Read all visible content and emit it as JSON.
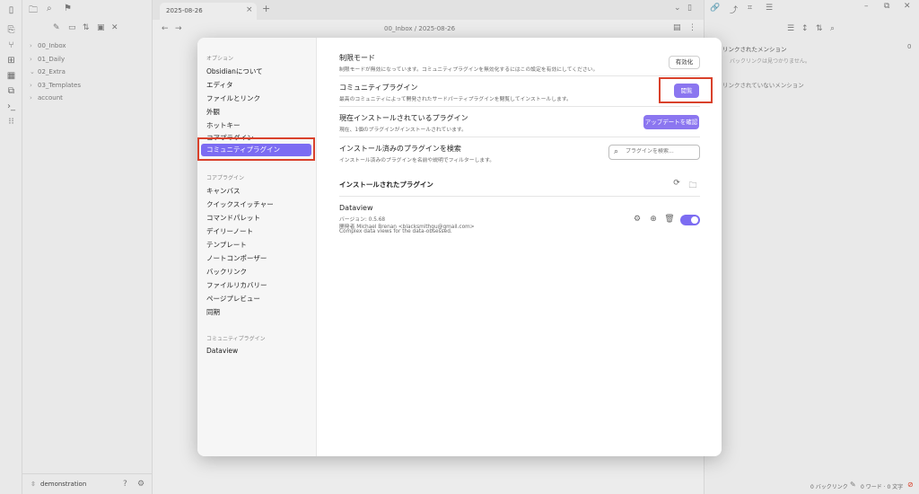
{
  "tab": {
    "title": "2025-08-26",
    "new_tab": "+"
  },
  "breadcrumb": {
    "path": "00_Inbox / 2025-08-26"
  },
  "file_tree": [
    "00_Inbox",
    "01_Daily",
    "02_Extra",
    "03_Templates",
    "account"
  ],
  "vault": {
    "name": "demonstration"
  },
  "right_panel": {
    "linked_title": "リンクされたメンション",
    "linked_empty": "バックリンクは見つかりません。",
    "unlinked_title": "リンクされていないメンション"
  },
  "status_bar": {
    "backlinks": "0 バックリンク",
    "words": "0 ワード · 0 文字"
  },
  "settings": {
    "section_options": "オプション",
    "options": [
      "Obsidianについて",
      "エディタ",
      "ファイルとリンク",
      "外観",
      "ホットキー",
      "コアプラグイン"
    ],
    "active_item": "コミュニティプラグイン",
    "section_core": "コアプラグイン",
    "core_plugins": [
      "キャンバス",
      "クイックスイッチャー",
      "コマンドパレット",
      "デイリーノート",
      "テンプレート",
      "ノートコンポーザー",
      "バックリンク",
      "ファイルリカバリー",
      "ページプレビュー",
      "同期"
    ],
    "section_community": "コミュニティプラグイン",
    "community_plugins": [
      "Dataview"
    ]
  },
  "content": {
    "restricted_title": "制限モード",
    "restricted_desc": "制限モードが無効になっています。コミュニティプラグインを無効化するにはこの設定を有効にしてください。",
    "restricted_btn": "有効化",
    "community_title": "コミュニティプラグイン",
    "community_desc": "最高のコミュニティによって開発されたサードパーティプラグインを閲覧してインストールします。",
    "browse_btn": "閲覧",
    "installed_now_title": "現在インストールされているプラグイン",
    "installed_now_desc": "現在、1個のプラグインがインストールされています。",
    "update_btn": "アップデートを確認",
    "search_title": "インストール済みのプラグインを検索",
    "search_desc": "インストール済みのプラグインを名前や説明でフィルターします。",
    "search_placeholder": "プラグインを検索...",
    "installed_header": "インストールされたプラグイン",
    "plugin": {
      "name": "Dataview",
      "version": "バージョン: 0.5.68",
      "author": "開発者 Michael Brenan <blacksmithgu@gmail.com>",
      "description": "Complex data views for the data-obsessed.",
      "enabled": true
    }
  }
}
